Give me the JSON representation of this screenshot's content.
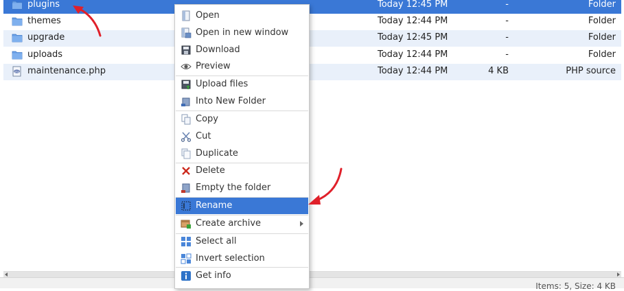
{
  "files": [
    {
      "name": "plugins",
      "date": "Today 12:45 PM",
      "size": "-",
      "kind": "Folder",
      "type": "folder",
      "selected": true
    },
    {
      "name": "themes",
      "date": "Today 12:44 PM",
      "size": "-",
      "kind": "Folder",
      "type": "folder"
    },
    {
      "name": "upgrade",
      "date": "Today 12:45 PM",
      "size": "-",
      "kind": "Folder",
      "type": "folder"
    },
    {
      "name": "uploads",
      "date": "Today 12:44 PM",
      "size": "-",
      "kind": "Folder",
      "type": "folder"
    },
    {
      "name": "maintenance.php",
      "date": "Today 12:44 PM",
      "size": "4 KB",
      "kind": "PHP source",
      "type": "php"
    }
  ],
  "context_menu": {
    "items": [
      {
        "label": "Open",
        "icon": "open-icon"
      },
      {
        "label": "Open in new window",
        "icon": "open-new-window-icon"
      },
      {
        "label": "Download",
        "icon": "download-icon"
      },
      {
        "label": "Preview",
        "icon": "preview-eye-icon"
      },
      {
        "label": "Upload files",
        "icon": "upload-icon"
      },
      {
        "label": "Into New Folder",
        "icon": "into-new-folder-icon"
      },
      {
        "label": "Copy",
        "icon": "copy-icon"
      },
      {
        "label": "Cut",
        "icon": "cut-icon"
      },
      {
        "label": "Duplicate",
        "icon": "duplicate-icon"
      },
      {
        "label": "Delete",
        "icon": "delete-icon"
      },
      {
        "label": "Empty the folder",
        "icon": "empty-folder-icon"
      },
      {
        "label": "Rename",
        "icon": "rename-icon",
        "active": true
      },
      {
        "label": "Create archive",
        "icon": "archive-icon",
        "submenu": true
      },
      {
        "label": "Select all",
        "icon": "select-all-icon"
      },
      {
        "label": "Invert selection",
        "icon": "invert-selection-icon"
      },
      {
        "label": "Get info",
        "icon": "info-icon"
      }
    ]
  },
  "status": {
    "text": "Items: 5, Size: 4 KB"
  },
  "colors": {
    "selection": "#3a78d6",
    "row_alt": "#e9f0fa",
    "arrow": "#e0202a"
  }
}
